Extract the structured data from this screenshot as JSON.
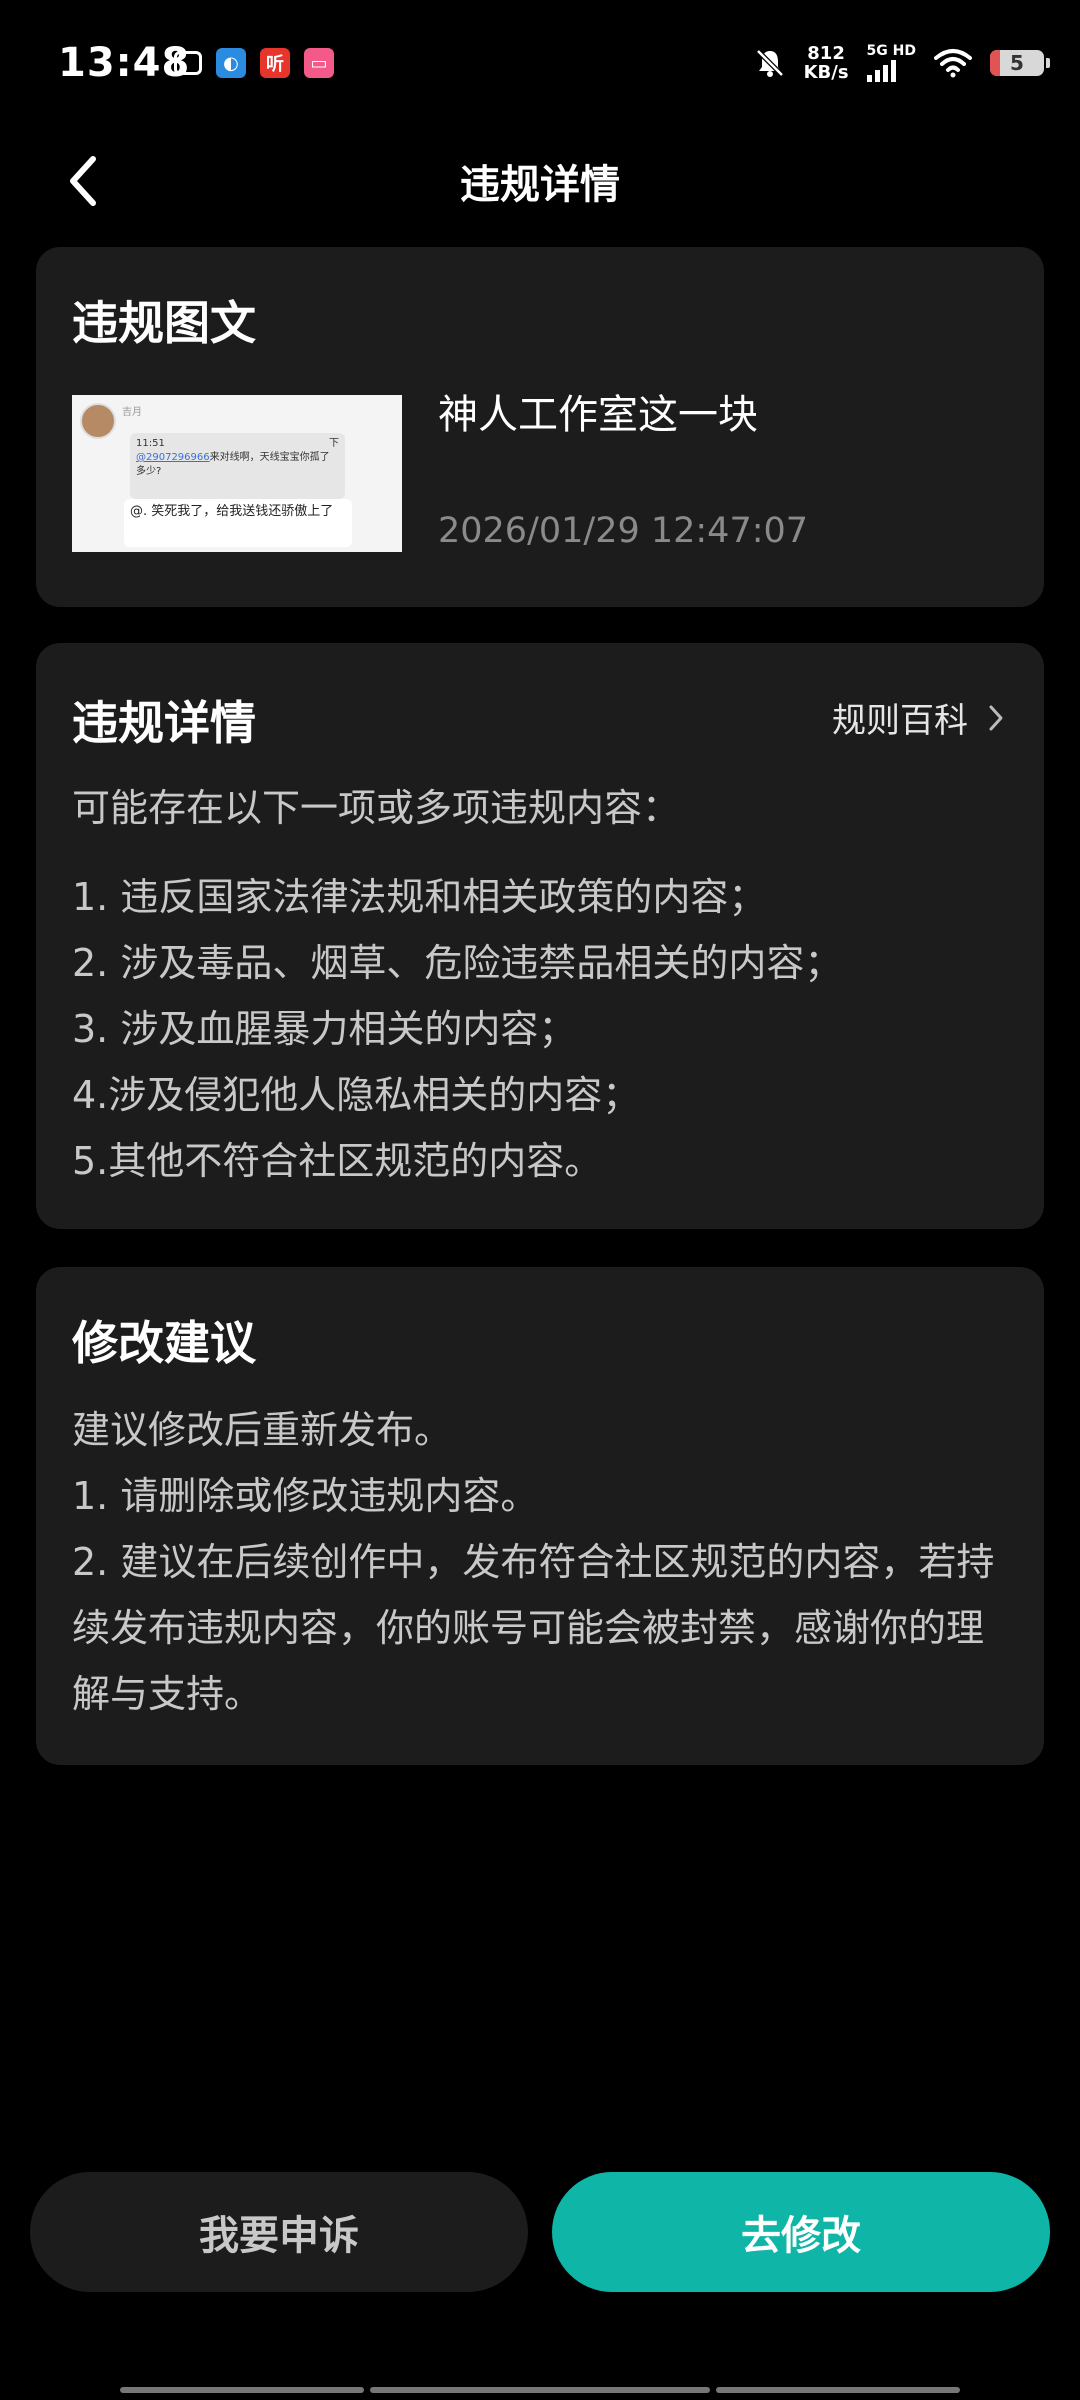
{
  "status_bar": {
    "time": "13:48",
    "speed_value": "812",
    "speed_unit": "KB/s",
    "network": "5G HD",
    "battery": "5",
    "app_icons": [
      "tv-icon",
      "browser-icon",
      "ting-icon",
      "bilibili-icon"
    ],
    "app_icon_labels": [
      "",
      "",
      "听",
      ""
    ]
  },
  "header": {
    "title": "违规详情"
  },
  "violation_content": {
    "heading": "违规图文",
    "post_title": "神人工作室这一块",
    "post_time": "2026/01/29 12:47:07",
    "thumbnail": {
      "username": "吉月",
      "msg_time": "11:51",
      "mention": "@2907296966",
      "msg1": "来对线啊，天线宝宝你孤了多少?",
      "reply": "@. 笑死我了，给我送钱还骄傲上了"
    }
  },
  "violation_details": {
    "heading": "违规详情",
    "rules_link": "规则百科",
    "intro": "可能存在以下一项或多项违规内容：",
    "items": [
      "1. 违反国家法律法规和相关政策的内容；",
      "2. 涉及毒品、烟草、危险违禁品相关的内容；",
      "3. 涉及血腥暴力相关的内容；",
      "4.涉及侵犯他人隐私相关的内容；",
      "5.其他不符合社区规范的内容。"
    ]
  },
  "suggestions": {
    "heading": "修改建议",
    "lines": [
      "建议修改后重新发布。",
      "1. 请删除或修改违规内容。",
      "2. 建议在后续创作中，发布符合社区规范的内容，若持续发布违规内容，你的账号可能会被封禁，感谢你的理解与支持。"
    ]
  },
  "buttons": {
    "appeal": "我要申诉",
    "edit": "去修改"
  },
  "colors": {
    "background": "#000000",
    "card": "#1c1c1c",
    "accent": "#0fb5a6"
  }
}
